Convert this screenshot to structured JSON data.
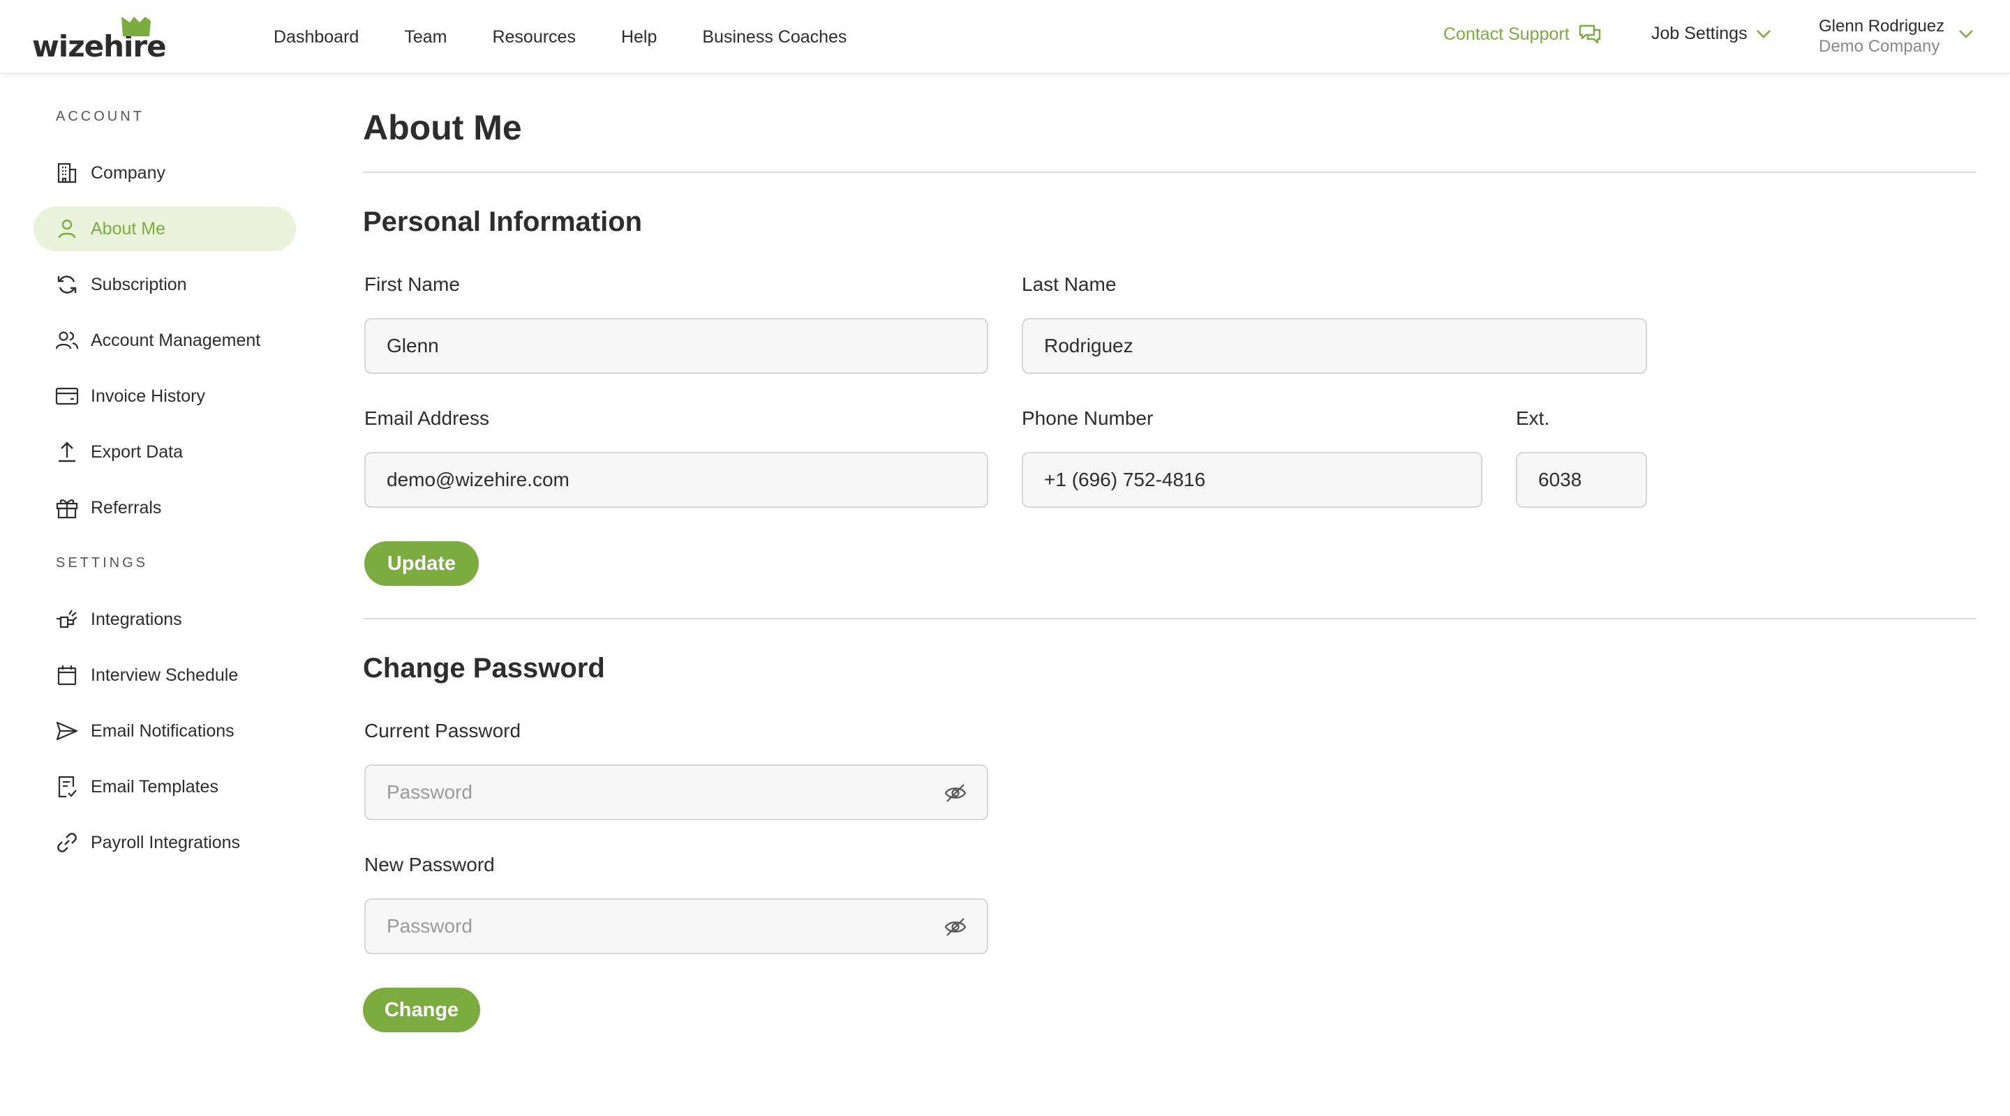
{
  "brand": {
    "name": "wizehire",
    "accent": "#7cab3f"
  },
  "nav": {
    "links": [
      "Dashboard",
      "Team",
      "Resources",
      "Help",
      "Business Coaches"
    ],
    "contact_support": "Contact Support",
    "job_settings": "Job Settings",
    "user_name": "Glenn Rodriguez",
    "user_company": "Demo Company"
  },
  "sidebar": {
    "account_label": "ACCOUNT",
    "settings_label": "SETTINGS",
    "items": [
      {
        "label": "Company",
        "icon": "building-icon"
      },
      {
        "label": "About Me",
        "icon": "user-icon",
        "active": true
      },
      {
        "label": "Subscription",
        "icon": "refresh-icon"
      },
      {
        "label": "Account Management",
        "icon": "users-icon"
      },
      {
        "label": "Invoice History",
        "icon": "credit-card-icon"
      },
      {
        "label": "Export Data",
        "icon": "upload-icon"
      },
      {
        "label": "Referrals",
        "icon": "gift-icon"
      },
      {
        "label": "Integrations",
        "icon": "plug-icon"
      },
      {
        "label": "Interview Schedule",
        "icon": "calendar-icon"
      },
      {
        "label": "Email Notifications",
        "icon": "send-icon"
      },
      {
        "label": "Email Templates",
        "icon": "document-check-icon"
      },
      {
        "label": "Payroll Integrations",
        "icon": "link-icon"
      }
    ]
  },
  "main": {
    "title": "About Me",
    "personal": {
      "title": "Personal Information",
      "first_name_label": "First Name",
      "first_name": "Glenn",
      "last_name_label": "Last Name",
      "last_name": "Rodriguez",
      "email_label": "Email Address",
      "email": "demo@wizehire.com",
      "phone_label": "Phone Number",
      "phone": "+1 (696) 752-4816",
      "ext_label": "Ext.",
      "ext": "6038",
      "update_label": "Update"
    },
    "password": {
      "title": "Change Password",
      "current_label": "Current Password",
      "current_placeholder": "Password",
      "new_label": "New Password",
      "new_placeholder": "Password",
      "change_label": "Change"
    }
  }
}
